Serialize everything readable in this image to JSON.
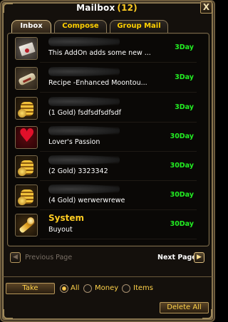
{
  "window": {
    "title": "Mailbox",
    "count": "(12)",
    "close_glyph": "X"
  },
  "tabs": [
    {
      "label": "Inbox",
      "active": true
    },
    {
      "label": "Compose",
      "active": false
    },
    {
      "label": "Group Mail",
      "active": false
    }
  ],
  "mails": [
    {
      "icon": "letter-icon",
      "sender": "",
      "subject": "This AddOn adds some new ...",
      "days": "3Day"
    },
    {
      "icon": "recipe-scroll-icon",
      "sender": "",
      "subject": "Recipe -Enhanced Moontou...",
      "days": "3Day"
    },
    {
      "icon": "gold-coins-icon",
      "sender": "",
      "subject": "(1 Gold) fsdfsdfsdfsdf",
      "days": "3Day"
    },
    {
      "icon": "heart-icon",
      "sender": "",
      "subject": "Lover's Passion",
      "days": "30Day"
    },
    {
      "icon": "gold-coins-icon",
      "sender": "",
      "subject": "(2 Gold) 3323342",
      "days": "30Day"
    },
    {
      "icon": "gold-coins-icon",
      "sender": "",
      "subject": "(4 Gold) werwerwrewe",
      "days": "30Day"
    },
    {
      "icon": "system-sword-icon",
      "sender": "System",
      "subject": "Buyout",
      "days": "30Day"
    }
  ],
  "pagination": {
    "prev_label": "Previous Page",
    "next_label": "Next Page",
    "prev_enabled": false,
    "next_enabled": true,
    "prev_icon": "arrow-left-icon",
    "next_icon": "arrow-right-icon"
  },
  "footer": {
    "take_label": "Take",
    "delete_all_label": "Delete All",
    "filter_options": [
      {
        "label": "All",
        "selected": true
      },
      {
        "label": "Money",
        "selected": false
      },
      {
        "label": "Items",
        "selected": false
      }
    ]
  },
  "colors": {
    "gold_text": "#ffcc22",
    "days_green": "#22ee22",
    "frame": "#8a7650"
  }
}
